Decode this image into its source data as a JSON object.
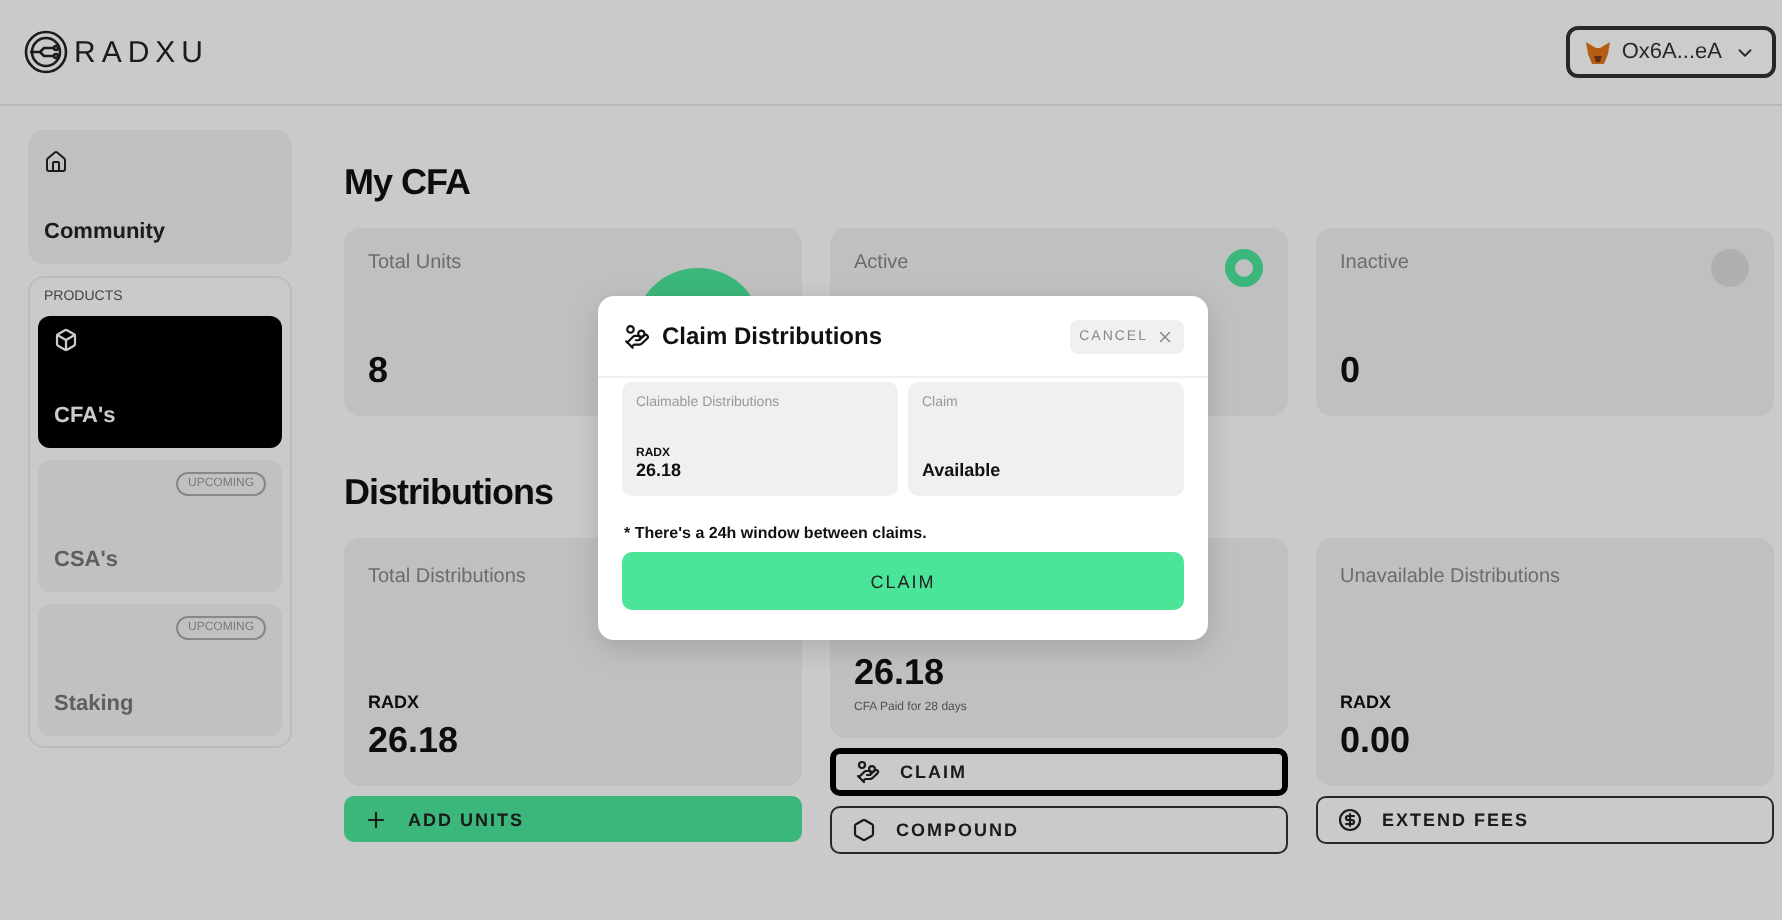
{
  "header": {
    "brand": "RADXU",
    "wallet": {
      "address": "Ox6A...eA"
    }
  },
  "sidebar": {
    "home": {
      "label": "Community",
      "selected": false
    },
    "section": "PRODUCTS",
    "products": [
      {
        "label": "CFA's",
        "selected": true
      },
      {
        "label": "CSA's",
        "badge": "UPCOMING",
        "selected": false
      },
      {
        "label": "Staking",
        "badge": "UPCOMING",
        "selected": false
      }
    ]
  },
  "my_cfa": {
    "title": "My CFA",
    "cards": [
      {
        "label": "Total Units",
        "value": "8"
      },
      {
        "label": "Active",
        "active": true
      },
      {
        "label": "Inactive",
        "value": "0",
        "active": false
      }
    ]
  },
  "distributions": {
    "title": "Distributions",
    "cards": [
      {
        "label": "Total Distributions",
        "currency": "RADX",
        "value": "26.18",
        "buttons": [
          {
            "label": "ADD UNITS",
            "kind": "primary"
          }
        ]
      },
      {
        "value": "26.18",
        "note": "CFA Paid for 28 days",
        "buttons": [
          {
            "label": "CLAIM",
            "kind": "outline",
            "focused": true
          },
          {
            "label": "COMPOUND",
            "kind": "outline",
            "focused": false
          }
        ]
      },
      {
        "label": "Unavailable Distributions",
        "currency": "RADX",
        "value": "0.00",
        "buttons": [
          {
            "label": "EXTEND FEES",
            "kind": "outline",
            "focused": false
          }
        ]
      }
    ]
  },
  "modal": {
    "title": "Claim Distributions",
    "cancel": "CANCEL",
    "panels": [
      {
        "label": "Claimable Distributions",
        "currency": "RADX",
        "value": "26.18"
      },
      {
        "label": "Claim",
        "value": "Available"
      }
    ],
    "note": "* There's a 24h window between claims.",
    "button": "CLAIM"
  }
}
